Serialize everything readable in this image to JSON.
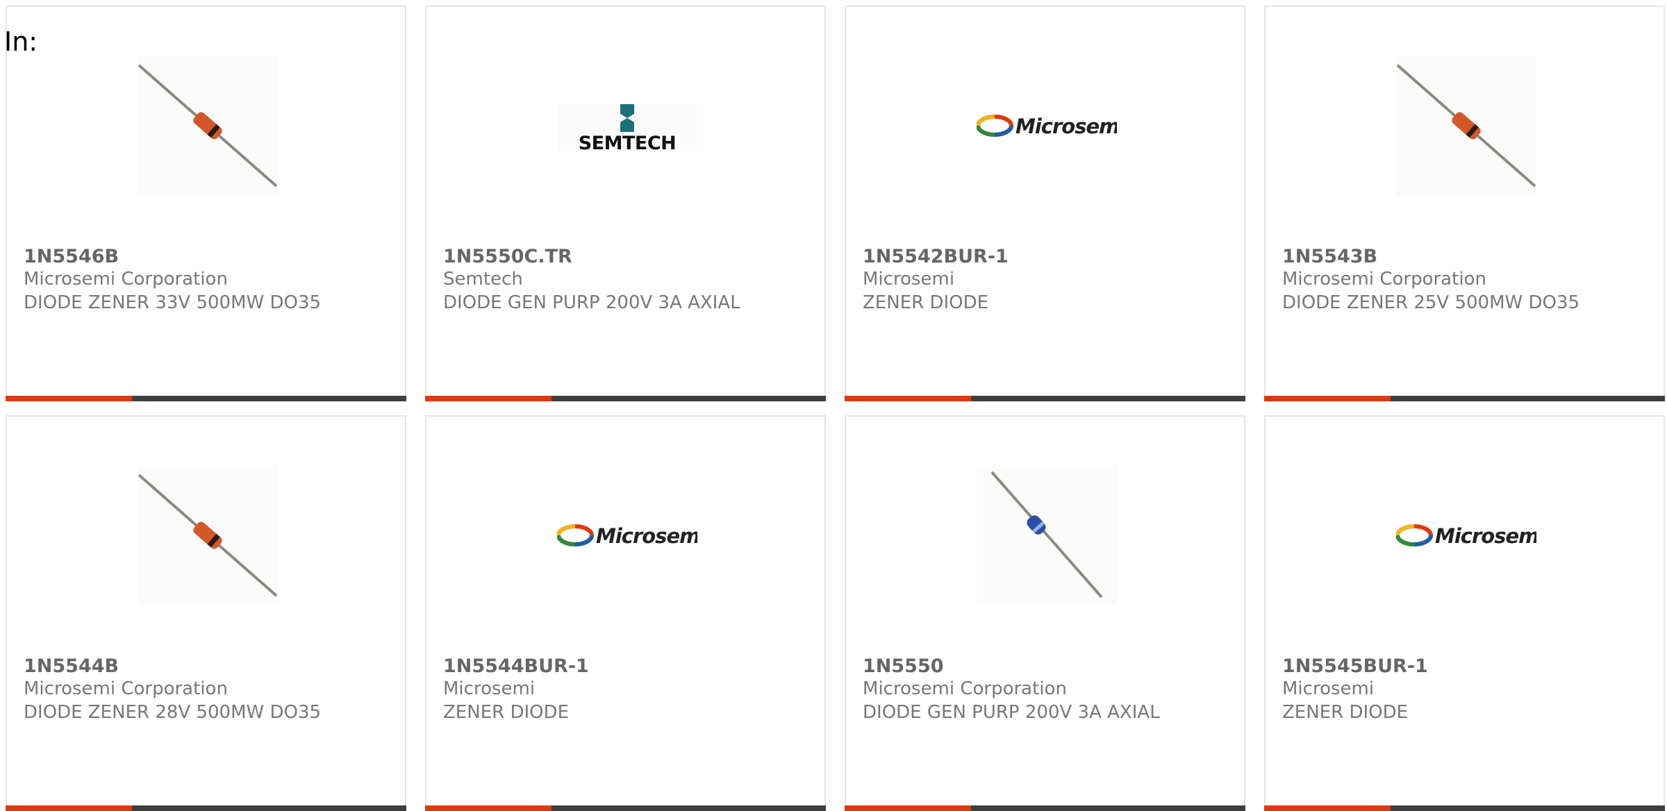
{
  "filter": {
    "in_label": "In:"
  },
  "theme": {
    "accent_color": "#e0380b",
    "bar_color": "#3e3e3e"
  },
  "products": [
    {
      "part_number": "1N5546B",
      "manufacturer": "Microsemi Corporation",
      "description": "DIODE ZENER 33V 500MW DO35",
      "image": "axial-diode-orange-image"
    },
    {
      "part_number": "1N5550C.TR",
      "manufacturer": "Semtech",
      "description": "DIODE GEN PURP 200V 3A AXIAL",
      "image": "semtech-logo",
      "logo_text": "SEMTECH"
    },
    {
      "part_number": "1N5542BUR-1",
      "manufacturer": "Microsemi",
      "description": "ZENER DIODE",
      "image": "microsemi-logo",
      "logo_text": "Microsemi"
    },
    {
      "part_number": "1N5543B",
      "manufacturer": "Microsemi Corporation",
      "description": "DIODE ZENER 25V 500MW DO35",
      "image": "axial-diode-orange-image"
    },
    {
      "part_number": "1N5544B",
      "manufacturer": "Microsemi Corporation",
      "description": "DIODE ZENER 28V 500MW DO35",
      "image": "axial-diode-orange-image"
    },
    {
      "part_number": "1N5544BUR-1",
      "manufacturer": "Microsemi",
      "description": "ZENER DIODE",
      "image": "microsemi-logo",
      "logo_text": "Microsemi"
    },
    {
      "part_number": "1N5550",
      "manufacturer": "Microsemi Corporation",
      "description": "DIODE GEN PURP 200V 3A AXIAL",
      "image": "axial-diode-blue-image"
    },
    {
      "part_number": "1N5545BUR-1",
      "manufacturer": "Microsemi",
      "description": "ZENER DIODE",
      "image": "microsemi-logo",
      "logo_text": "Microsemi"
    }
  ]
}
